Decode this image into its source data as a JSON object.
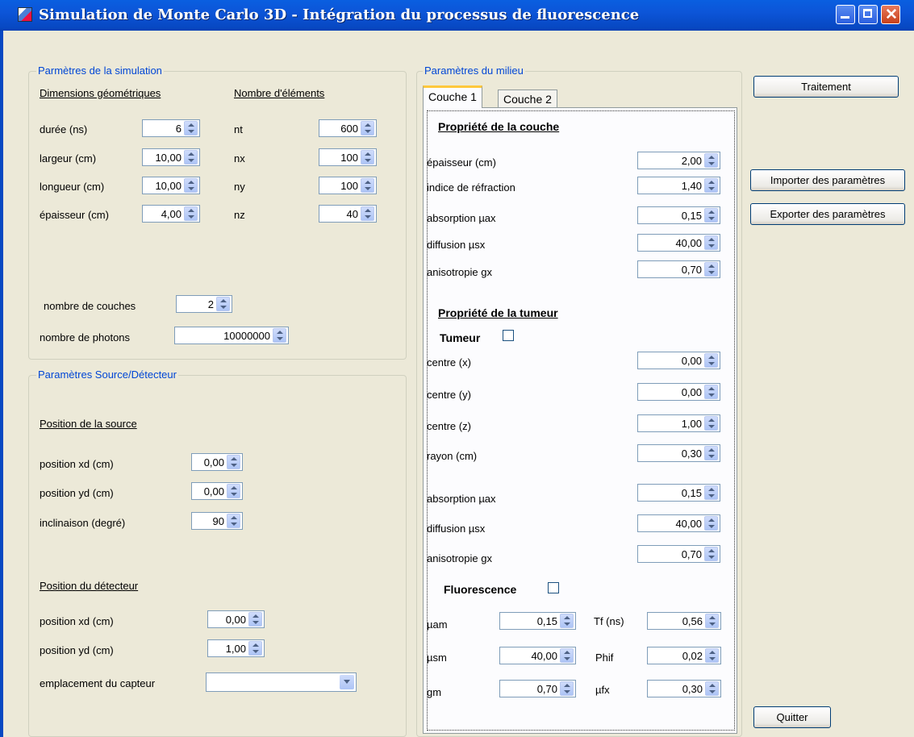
{
  "window": {
    "title": "Simulation de Monte Carlo 3D - Intégration du processus de fluorescence"
  },
  "sim": {
    "legend": "Parmètres de la simulation",
    "col1_header": "Dimensions géométriques",
    "col2_header": "Nombre d'éléments",
    "rows": [
      {
        "label": "durée (ns)",
        "value": "6",
        "label2": "nt",
        "value2": "600"
      },
      {
        "label": "largeur (cm)",
        "value": "10,00",
        "label2": "nx",
        "value2": "100"
      },
      {
        "label": "longueur (cm)",
        "value": "10,00",
        "label2": "ny",
        "value2": "100"
      },
      {
        "label": "épaisseur (cm)",
        "value": "4,00",
        "label2": "nz",
        "value2": "40"
      }
    ],
    "couches_label": "nombre de couches",
    "couches_value": "2",
    "photons_label": "nombre de photons",
    "photons_value": "10000000"
  },
  "source": {
    "legend": "Paramètres Source/Détecteur",
    "src_header": "Position de la source",
    "xd_label": "position xd (cm)",
    "xd_value": "0,00",
    "yd_label": "position yd (cm)",
    "yd_value": "0,00",
    "incl_label": "inclinaison (degré)",
    "incl_value": "90",
    "det_header": "Position du détecteur",
    "dxd_label": "position xd (cm)",
    "dxd_value": "0,00",
    "dyd_label": "position yd (cm)",
    "dyd_value": "1,00",
    "capteur_label": "emplacement du capteur",
    "capteur_value": ""
  },
  "milieu": {
    "legend": "Paramètres du milieu",
    "tabs": [
      "Couche 1",
      "Couche 2"
    ],
    "couche_header": "Propriété de la couche",
    "couche": [
      {
        "label": "épaisseur (cm)",
        "value": "2,00"
      },
      {
        "label": "indice de réfraction",
        "value": "1,40"
      },
      {
        "label": "absorption µax",
        "value": "0,15"
      },
      {
        "label": "diffusion µsx",
        "value": "40,00"
      },
      {
        "label": "anisotropie gx",
        "value": "0,70"
      }
    ],
    "tumeur_header": "Propriété de la tumeur",
    "tumeur_chk": "Tumeur",
    "tumeur": [
      {
        "label": "centre (x)",
        "value": "0,00"
      },
      {
        "label": "centre (y)",
        "value": "0,00"
      },
      {
        "label": "centre (z)",
        "value": "1,00"
      },
      {
        "label": "rayon (cm)",
        "value": "0,30"
      },
      {
        "label": "absorption µax",
        "value": "0,15"
      },
      {
        "label": "diffusion µsx",
        "value": "40,00"
      },
      {
        "label": "anisotropie gx",
        "value": "0,70"
      }
    ],
    "fluo_chk": "Fluorescence",
    "fluo": [
      {
        "label": "µam",
        "value": "0,15",
        "label2": "Tf (ns)",
        "value2": "0,56"
      },
      {
        "label": "µsm",
        "value": "40,00",
        "label2": "Phif",
        "value2": "0,02"
      },
      {
        "label": "gm",
        "value": "0,70",
        "label2": "µfx",
        "value2": "0,30"
      }
    ]
  },
  "buttons": {
    "traitement": "Traitement",
    "importer": "Importer des paramètres",
    "exporter": "Exporter des paramètres",
    "quitter": "Quitter"
  }
}
